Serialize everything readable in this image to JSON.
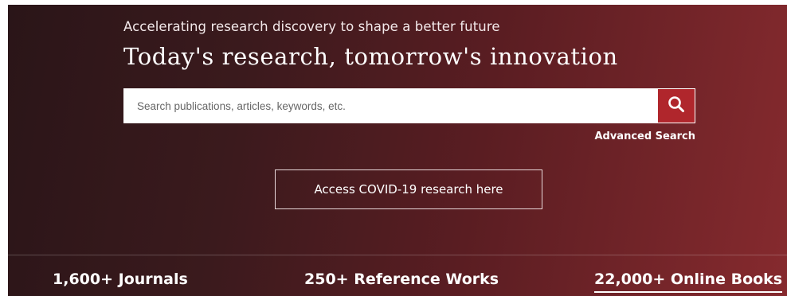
{
  "hero": {
    "tagline": "Accelerating research discovery to shape a better future",
    "headline": "Today's research, tomorrow's innovation"
  },
  "search": {
    "placeholder": "Search publications, articles, keywords, etc.",
    "button_icon": "search-icon",
    "advanced_label": "Advanced Search"
  },
  "covid": {
    "label": "Access COVID-19 research here"
  },
  "stats": [
    {
      "label": "1,600+ Journals"
    },
    {
      "label": "250+ Reference Works"
    },
    {
      "label": "22,000+ Online Books"
    }
  ],
  "colors": {
    "accent": "#b0262c",
    "bg_dark": "#2a1518",
    "bg_light": "#862a2e"
  }
}
